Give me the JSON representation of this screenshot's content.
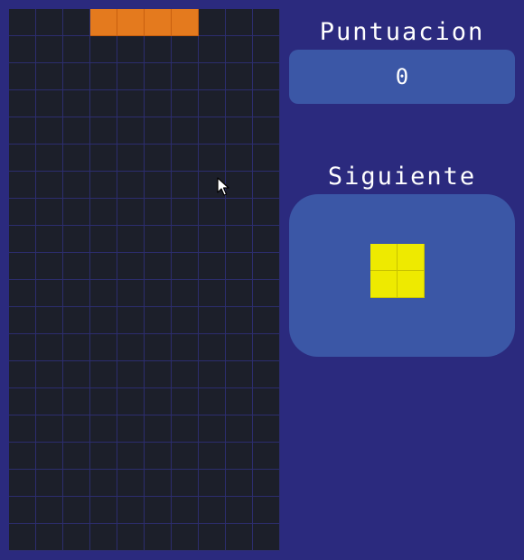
{
  "score": {
    "label": "Puntuacion",
    "value": "0"
  },
  "next": {
    "label": "Siguiente",
    "piece": "O",
    "color": "#eeea00",
    "cells": [
      [
        0,
        0
      ],
      [
        0,
        1
      ],
      [
        1,
        0
      ],
      [
        1,
        1
      ]
    ]
  },
  "board": {
    "cols": 10,
    "rows": 20,
    "empty_color": "#1c1f2a",
    "grid_line_color": "#2c2d6e",
    "active_piece": {
      "type": "I",
      "color": "#e47a1e",
      "cells": [
        [
          0,
          3
        ],
        [
          0,
          4
        ],
        [
          0,
          5
        ],
        [
          0,
          6
        ]
      ]
    }
  },
  "colors": {
    "background": "#2b2a7e",
    "panel": "#3b57a6",
    "text": "#ffffff"
  },
  "cursor": {
    "icon": "mouse-pointer-icon"
  }
}
